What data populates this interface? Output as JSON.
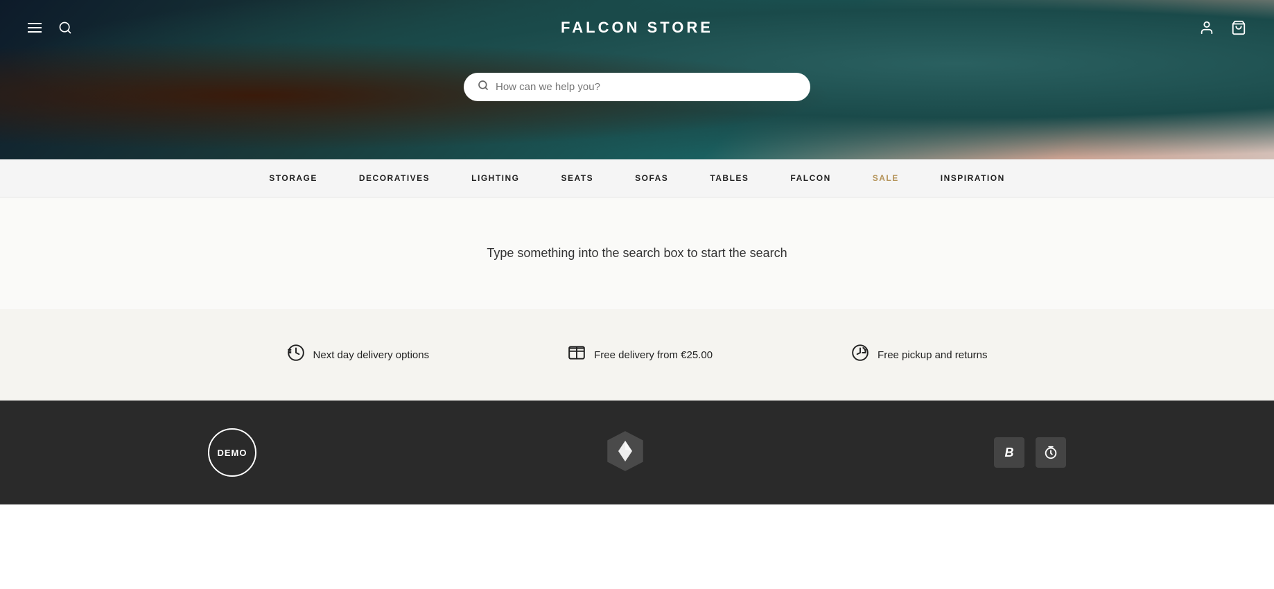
{
  "header": {
    "title": "FALCON STORE",
    "menu_icon": "menu-icon",
    "search_icon": "search-icon",
    "user_icon": "user-icon",
    "cart_icon": "cart-icon"
  },
  "hero": {
    "search_placeholder": "How can we help you?"
  },
  "nav": {
    "items": [
      {
        "label": "STORAGE",
        "sale": false
      },
      {
        "label": "DECORATIVES",
        "sale": false
      },
      {
        "label": "LIGHTING",
        "sale": false
      },
      {
        "label": "SEATS",
        "sale": false
      },
      {
        "label": "SOFAS",
        "sale": false
      },
      {
        "label": "TABLES",
        "sale": false
      },
      {
        "label": "FALCON",
        "sale": false
      },
      {
        "label": "SALE",
        "sale": true
      },
      {
        "label": "INSPIRATION",
        "sale": false
      }
    ]
  },
  "search_prompt": {
    "text": "Type something into the search box to start the search"
  },
  "features": [
    {
      "icon": "clock-delivery-icon",
      "label": "Next day delivery options"
    },
    {
      "icon": "box-delivery-icon",
      "label": "Free delivery from €25.00"
    },
    {
      "icon": "return-icon",
      "label": "Free pickup and returns"
    }
  ],
  "footer": {
    "demo_label": "DEMO",
    "b_label": "B",
    "timer_label": "⏱"
  }
}
